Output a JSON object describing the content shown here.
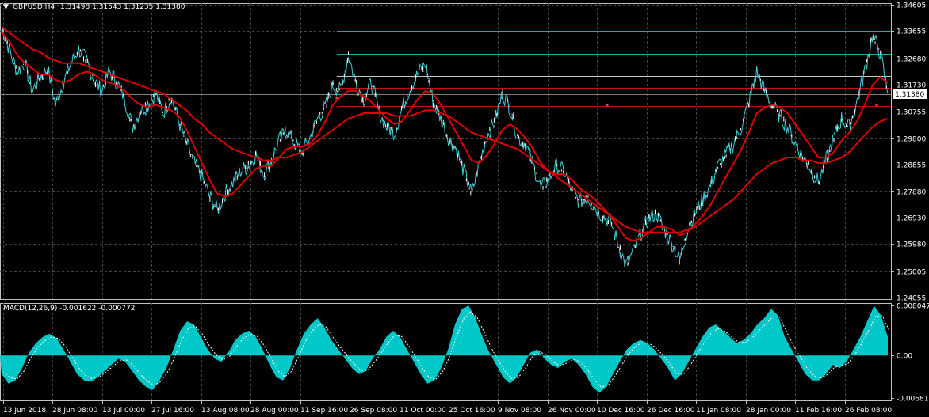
{
  "header": {
    "symbol": "GBPUSD,H4",
    "ohlc": "1.31498 1.31543 1.31235 1.31380",
    "arrow": "▼"
  },
  "macd_header": {
    "label": "MACD(12,26,9) -0.001622 -0.000772"
  },
  "colors": {
    "background": "#000000",
    "grid": "#3c4a4a",
    "price": "#40d0d8",
    "price_dark": "#ffffff",
    "ma": "#e00000",
    "hlines_cyan": "#2aa7a7",
    "hlines_red": "#c01010",
    "macd_hist": "#00c8c8",
    "macd_signal": "#ffffff",
    "frame": "#c0c0c0"
  },
  "chart_data": [
    {
      "type": "line",
      "title": "GBPUSD,H4",
      "x_tick_labels": [
        "13 Jun 2018",
        "28 Jun 08:00",
        "13 Jul 00:00",
        "27 Jul 16:00",
        "13 Aug 08:00",
        "28 Aug 00:00",
        "11 Sep 16:00",
        "26 Sep 08:00",
        "11 Oct 00:00",
        "25 Oct 16:00",
        "9 Nov 08:00",
        "26 Nov 00:00",
        "10 Dec 16:00",
        "26 Dec 16:00",
        "11 Jan 08:00",
        "28 Jan 00:00",
        "11 Feb 16:00",
        "26 Feb 08:00"
      ],
      "y_tick_labels": [
        "1.34605",
        "1.33655",
        "1.32680",
        "1.31730",
        "1.30755",
        "1.29800",
        "1.28855",
        "1.27880",
        "1.26930",
        "1.25980",
        "1.25005",
        "1.24055"
      ],
      "ylim": [
        1.24055,
        1.34605
      ],
      "current_price": "1.31380",
      "series": [
        {
          "name": "",
          "kind": "close",
          "values": [
            1.338,
            1.33,
            1.322,
            1.325,
            1.315,
            1.32,
            1.323,
            1.31,
            1.318,
            1.325,
            1.33,
            1.326,
            1.319,
            1.315,
            1.322,
            1.318,
            1.312,
            1.302,
            1.308,
            1.31,
            1.314,
            1.307,
            1.313,
            1.304,
            1.296,
            1.289,
            1.284,
            1.277,
            1.272,
            1.278,
            1.282,
            1.286,
            1.288,
            1.292,
            1.285,
            1.29,
            1.297,
            1.301,
            1.296,
            1.293,
            1.298,
            1.305,
            1.309,
            1.317,
            1.315,
            1.328,
            1.318,
            1.312,
            1.318,
            1.307,
            1.302,
            1.3,
            1.309,
            1.316,
            1.321,
            1.325,
            1.311,
            1.305,
            1.298,
            1.294,
            1.286,
            1.278,
            1.289,
            1.299,
            1.304,
            1.314,
            1.309,
            1.298,
            1.296,
            1.288,
            1.28,
            1.283,
            1.288,
            1.286,
            1.279,
            1.275,
            1.277,
            1.273,
            1.27,
            1.268,
            1.26,
            1.252,
            1.257,
            1.264,
            1.269,
            1.271,
            1.265,
            1.26,
            1.254,
            1.265,
            1.271,
            1.276,
            1.281,
            1.288,
            1.292,
            1.296,
            1.302,
            1.311,
            1.322,
            1.315,
            1.31,
            1.306,
            1.302,
            1.296,
            1.291,
            1.287,
            1.282,
            1.29,
            1.298,
            1.305,
            1.302,
            1.311,
            1.322,
            1.335,
            1.329,
            1.314
          ]
        },
        {
          "name": "",
          "kind": "ma_fast",
          "values": [
            1.336,
            1.333,
            1.328,
            1.325,
            1.323,
            1.321,
            1.321,
            1.319,
            1.318,
            1.319,
            1.321,
            1.322,
            1.321,
            1.319,
            1.318,
            1.317,
            1.315,
            1.312,
            1.31,
            1.309,
            1.31,
            1.309,
            1.308,
            1.306,
            1.301,
            1.295,
            1.289,
            1.283,
            1.278,
            1.277,
            1.278,
            1.281,
            1.284,
            1.287,
            1.288,
            1.288,
            1.291,
            1.294,
            1.295,
            1.295,
            1.296,
            1.299,
            1.304,
            1.31,
            1.313,
            1.315,
            1.315,
            1.313,
            1.311,
            1.308,
            1.305,
            1.303,
            1.304,
            1.308,
            1.312,
            1.315,
            1.314,
            1.31,
            1.305,
            1.3,
            1.295,
            1.29,
            1.289,
            1.292,
            1.296,
            1.301,
            1.303,
            1.301,
            1.298,
            1.294,
            1.289,
            1.286,
            1.285,
            1.285,
            1.283,
            1.28,
            1.278,
            1.276,
            1.273,
            1.27,
            1.266,
            1.262,
            1.261,
            1.262,
            1.264,
            1.266,
            1.266,
            1.265,
            1.263,
            1.264,
            1.267,
            1.27,
            1.274,
            1.279,
            1.284,
            1.289,
            1.294,
            1.3,
            1.307,
            1.309,
            1.31,
            1.309,
            1.307,
            1.303,
            1.299,
            1.295,
            1.291,
            1.291,
            1.293,
            1.297,
            1.3,
            1.304,
            1.31,
            1.317,
            1.32,
            1.318
          ]
        },
        {
          "name": "",
          "kind": "ma_slow",
          "values": [
            1.338,
            1.336,
            1.334,
            1.332,
            1.33,
            1.329,
            1.327,
            1.326,
            1.325,
            1.325,
            1.325,
            1.324,
            1.323,
            1.322,
            1.321,
            1.32,
            1.319,
            1.318,
            1.317,
            1.316,
            1.315,
            1.314,
            1.312,
            1.31,
            1.308,
            1.305,
            1.303,
            1.3,
            1.298,
            1.296,
            1.294,
            1.293,
            1.292,
            1.291,
            1.29,
            1.29,
            1.291,
            1.291,
            1.292,
            1.293,
            1.295,
            1.297,
            1.299,
            1.301,
            1.303,
            1.305,
            1.306,
            1.307,
            1.307,
            1.307,
            1.307,
            1.306,
            1.306,
            1.306,
            1.307,
            1.308,
            1.308,
            1.307,
            1.306,
            1.304,
            1.302,
            1.3,
            1.299,
            1.298,
            1.297,
            1.296,
            1.295,
            1.294,
            1.292,
            1.29,
            1.288,
            1.286,
            1.284,
            1.282,
            1.28,
            1.278,
            1.276,
            1.274,
            1.272,
            1.27,
            1.268,
            1.266,
            1.265,
            1.264,
            1.264,
            1.264,
            1.264,
            1.264,
            1.264,
            1.265,
            1.266,
            1.268,
            1.27,
            1.272,
            1.274,
            1.276,
            1.279,
            1.282,
            1.285,
            1.287,
            1.289,
            1.29,
            1.291,
            1.291,
            1.29,
            1.29,
            1.289,
            1.289,
            1.29,
            1.291,
            1.293,
            1.296,
            1.299,
            1.302,
            1.304,
            1.305
          ]
        }
      ],
      "horizontal_levels": [
        {
          "value": 1.3365,
          "color": "cyan"
        },
        {
          "value": 1.3285,
          "color": "cyan"
        },
        {
          "value": 1.3205,
          "color": "white"
        },
        {
          "value": 1.316,
          "color": "red"
        },
        {
          "value": 1.3095,
          "color": "red"
        },
        {
          "value": 1.302,
          "color": "red"
        }
      ]
    },
    {
      "type": "area",
      "title": "MACD(12,26,9) -0.001622 -0.000772",
      "y_tick_labels": [
        "0.008047",
        "0.00",
        "-0.006819"
      ],
      "ylim": [
        -0.006819,
        0.008047
      ],
      "series": [
        {
          "name": "",
          "kind": "histogram",
          "values": [
            -0.003,
            -0.0045,
            -0.004,
            -0.002,
            0.0005,
            0.002,
            0.003,
            0.0035,
            0.0028,
            0.001,
            -0.001,
            -0.003,
            -0.004,
            -0.0042,
            -0.0035,
            -0.0025,
            -0.0015,
            -0.0005,
            -0.001,
            -0.0025,
            -0.004,
            -0.005,
            -0.0055,
            -0.004,
            -0.002,
            0.001,
            0.004,
            0.0055,
            0.005,
            0.003,
            0.001,
            -0.0005,
            -0.001,
            0.0005,
            0.0025,
            0.0035,
            0.004,
            0.003,
            0.001,
            -0.0015,
            -0.0035,
            -0.004,
            -0.002,
            0.001,
            0.0035,
            0.005,
            0.006,
            0.0045,
            0.0025,
            0.001,
            -0.0005,
            -0.002,
            -0.003,
            -0.0025,
            -0.0005,
            0.001,
            0.003,
            0.004,
            0.003,
            0.001,
            -0.001,
            -0.003,
            -0.0045,
            -0.004,
            -0.002,
            0.001,
            0.005,
            0.0075,
            0.008,
            0.006,
            0.003,
            0.0005,
            -0.0015,
            -0.0035,
            -0.0045,
            -0.0035,
            -0.0015,
            0.0005,
            0.001,
            -0.0005,
            -0.0015,
            -0.002,
            -0.001,
            -0.0005,
            -0.0015,
            -0.003,
            -0.005,
            -0.006,
            -0.005,
            -0.003,
            -0.001,
            0.001,
            0.002,
            0.0025,
            0.002,
            0.001,
            -0.0005,
            -0.002,
            -0.004,
            -0.003,
            -0.001,
            0.001,
            0.003,
            0.0045,
            0.005,
            0.004,
            0.003,
            0.002,
            0.0025,
            0.0035,
            0.005,
            0.006,
            0.0075,
            0.0065,
            0.003,
            0.001,
            -0.001,
            -0.003,
            -0.004,
            -0.004,
            -0.003,
            -0.0015,
            -0.002,
            -0.001,
            0.001,
            0.003,
            0.0055,
            0.008,
            0.0065,
            0.003
          ]
        }
      ]
    }
  ]
}
